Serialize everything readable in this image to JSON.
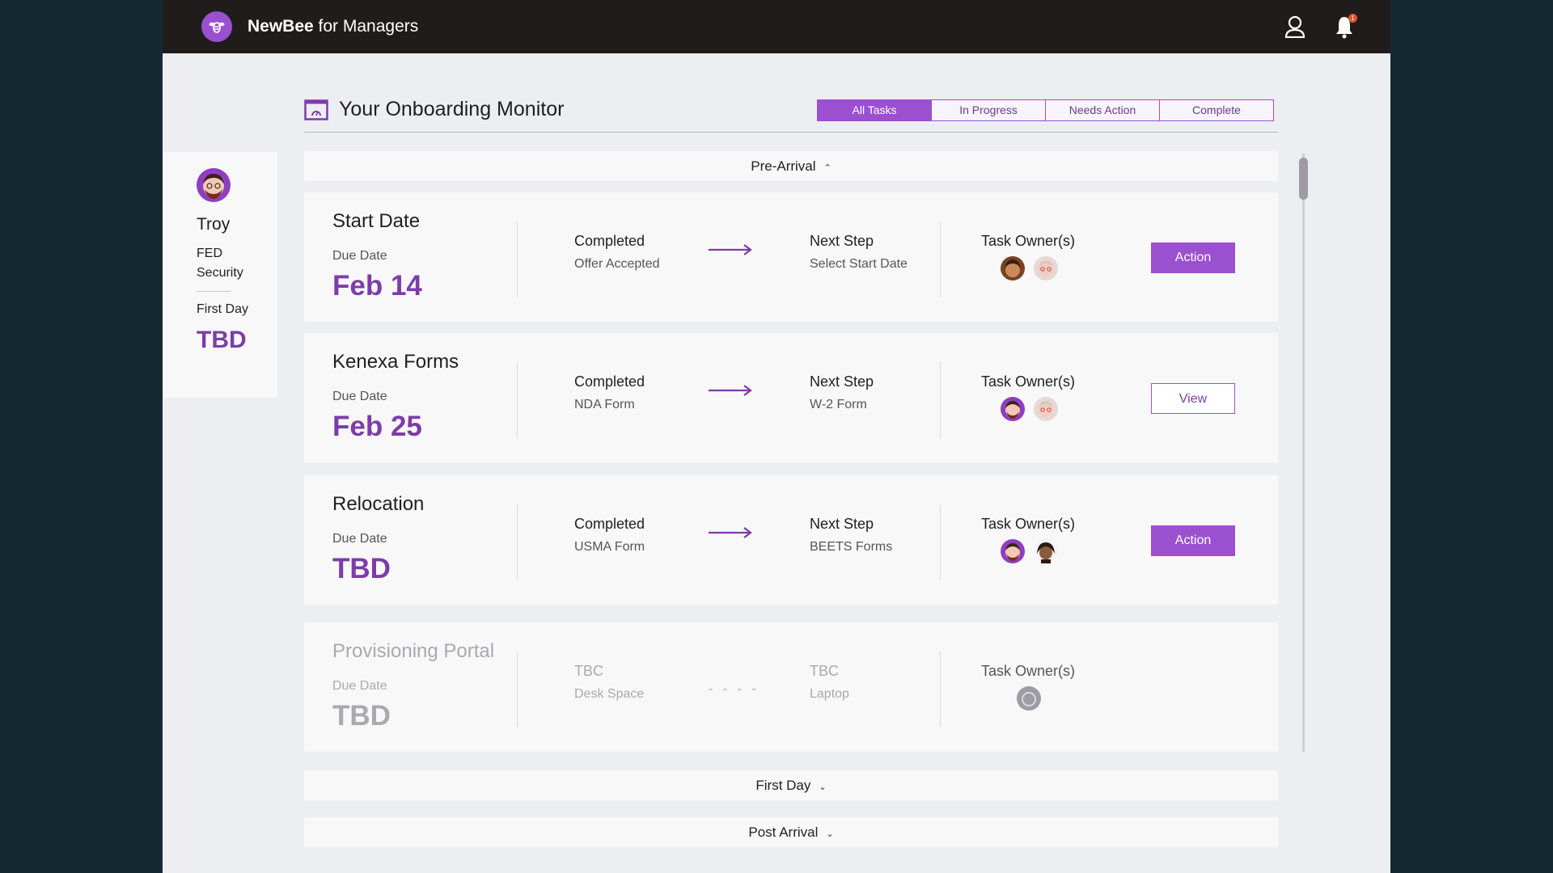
{
  "header": {
    "brand_bold": "NewBee",
    "brand_rest": " for Managers",
    "notification_count": "1",
    "icons": {
      "logo": "bee-logo-icon",
      "user": "user-icon",
      "bell": "bell-icon"
    }
  },
  "profile": {
    "name": "Troy",
    "role_line1": "FED",
    "role_line2": "Security",
    "first_day_label": "First Day",
    "first_day_value": "TBD"
  },
  "monitor": {
    "title": "Your Onboarding Monitor",
    "tabs": [
      {
        "label": "All Tasks",
        "active": true
      },
      {
        "label": "In Progress",
        "active": false
      },
      {
        "label": "Needs Action",
        "active": false
      },
      {
        "label": "Complete",
        "active": false
      }
    ]
  },
  "sections": {
    "pre_arrival": "Pre-Arrival",
    "first_day": "First Day",
    "post_arrival": "Post Arrival"
  },
  "tasks": [
    {
      "title": "Start Date",
      "due_label": "Due Date",
      "due_value": "Feb 14",
      "completed_label": "Completed",
      "completed_value": "Offer Accepted",
      "next_label": "Next Step",
      "next_value": "Select Start Date",
      "owners_label": "Task Owner(s)",
      "button": "Action"
    },
    {
      "title": "Kenexa Forms",
      "due_label": "Due Date",
      "due_value": "Feb 25",
      "completed_label": "Completed",
      "completed_value": "NDA Form",
      "next_label": "Next Step",
      "next_value": "W-2 Form",
      "owners_label": "Task Owner(s)",
      "button": "View"
    },
    {
      "title": "Relocation",
      "due_label": "Due Date",
      "due_value": "TBD",
      "completed_label": "Completed",
      "completed_value": "USMA Form",
      "next_label": "Next Step",
      "next_value": "BEETS Forms",
      "owners_label": "Task Owner(s)",
      "button": "Action"
    },
    {
      "title": "Provisioning Portal",
      "due_label": "Due Date",
      "due_value": "TBD",
      "completed_label": "TBC",
      "completed_value": "Desk Space",
      "next_label": "TBC",
      "next_value": "Laptop",
      "owners_label": "Task Owner(s)"
    }
  ],
  "colors": {
    "accent": "#9b50d0",
    "accent_dark": "#7d3ca8",
    "topbar": "#211c1c",
    "backdrop": "#132a33",
    "notification": "#e0532b"
  }
}
